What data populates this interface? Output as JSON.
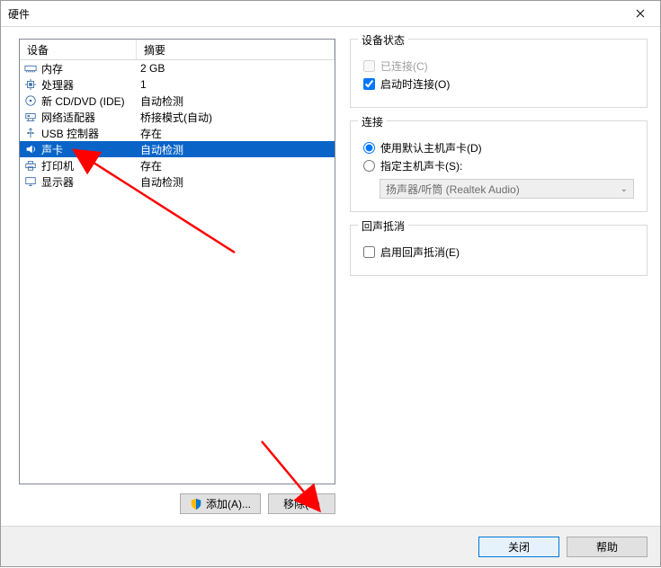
{
  "window_title": "硬件",
  "columns": {
    "device": "设备",
    "summary": "摘要"
  },
  "devices": [
    {
      "icon": "memory-icon",
      "name": "内存",
      "summary": "2 GB"
    },
    {
      "icon": "cpu-icon",
      "name": "处理器",
      "summary": "1"
    },
    {
      "icon": "cd-icon",
      "name": "新 CD/DVD (IDE)",
      "summary": "自动检测"
    },
    {
      "icon": "network-icon",
      "name": "网络适配器",
      "summary": "桥接模式(自动)"
    },
    {
      "icon": "usb-icon",
      "name": "USB 控制器",
      "summary": "存在"
    },
    {
      "icon": "sound-icon",
      "name": "声卡",
      "summary": "自动检测",
      "selected": true
    },
    {
      "icon": "printer-icon",
      "name": "打印机",
      "summary": "存在"
    },
    {
      "icon": "display-icon",
      "name": "显示器",
      "summary": "自动检测"
    }
  ],
  "buttons": {
    "add": "添加(A)...",
    "remove": "移除(R)",
    "close": "关闭",
    "help": "帮助"
  },
  "status_group": {
    "legend": "设备状态",
    "connected": "已连接(C)",
    "connect_on_start": "启动时连接(O)",
    "connected_checked": false,
    "connect_on_start_checked": true
  },
  "connect_group": {
    "legend": "连接",
    "use_default": "使用默认主机声卡(D)",
    "specify": "指定主机声卡(S):",
    "selected_radio": "use_default",
    "dropdown_value": "扬声器/听筒 (Realtek Audio)"
  },
  "echo_group": {
    "legend": "回声抵消",
    "enable": "启用回声抵消(E)",
    "enable_checked": false
  }
}
